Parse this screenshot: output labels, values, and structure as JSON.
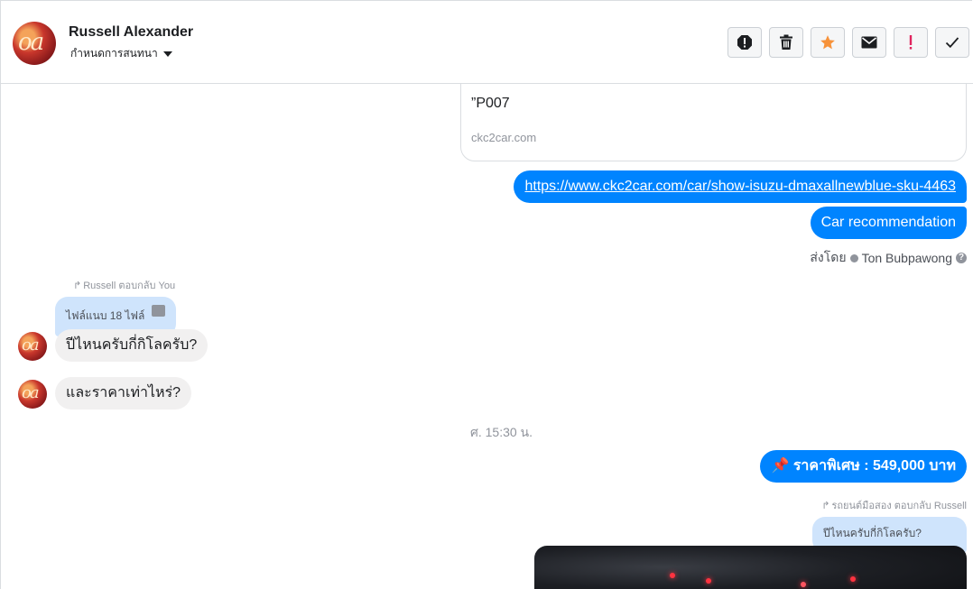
{
  "header": {
    "name": "Russell Alexander",
    "assign_label": "กำหนดการสนทนา",
    "actions": [
      "spam-icon",
      "trash-icon",
      "star-icon",
      "envelope-icon",
      "exclamation-icon",
      "check-icon"
    ],
    "colors": {
      "star": "#f7923a",
      "exclamation": "#e0245e"
    }
  },
  "messages": {
    "card": {
      "text": "”P007",
      "domain": "ckc2car.com"
    },
    "outgoing": [
      {
        "text": "https://www.ckc2car.com/car/show-isuzu-dmaxallnewblue-sku-4463"
      },
      {
        "text": "Car recommendation"
      }
    ],
    "sent_by": {
      "prefix": "ส่งโดย",
      "name": "Ton Bubpawong"
    },
    "reply1": {
      "note": "Russell ตอบกลับ You",
      "quote": "ไฟล์แนบ 18 ไฟล์"
    },
    "incoming": [
      {
        "text": "ปีไหนครับกี่กิโลครับ?"
      },
      {
        "text": "และราคาเท่าไหร่?"
      }
    ],
    "timestamp": "ศ. 15:30 น.",
    "price": {
      "text": "📌 ราคาพิเศษ : 549,000 บาท"
    },
    "reply2": {
      "note": "รถยนต์มือสอง ตอบกลับ Russell",
      "quote": "ปีไหนครับกี่กิโลครับ?"
    },
    "accent_color": "#0084ff"
  }
}
